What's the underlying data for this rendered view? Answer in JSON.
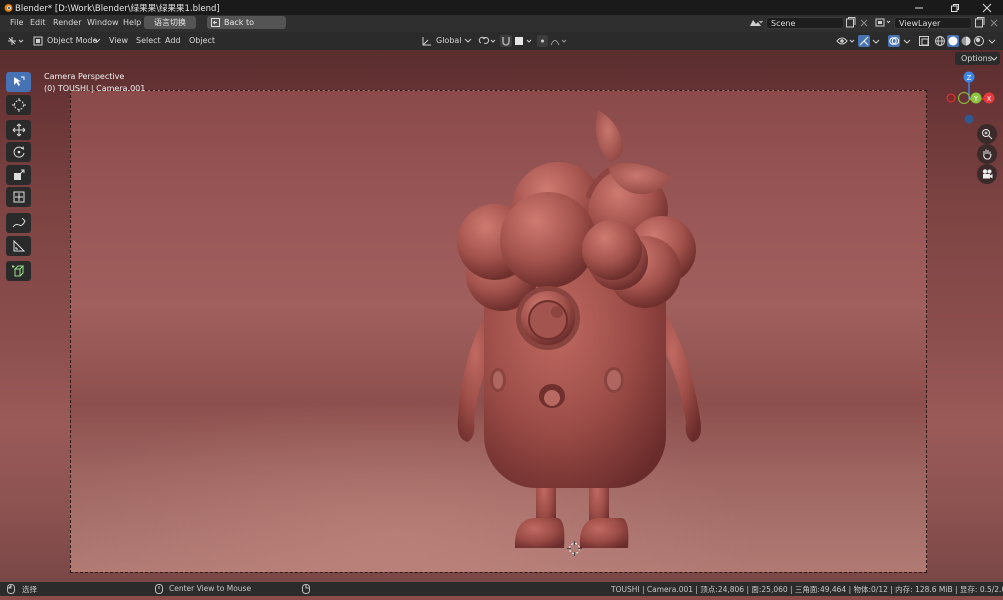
{
  "window": {
    "title": "Blender* [D:\\Work\\Blender\\绿果果\\绿果果1.blend]",
    "minimize_icon": "minimize-icon",
    "maximize_icon": "restore-icon",
    "close_icon": "close-icon"
  },
  "menu": {
    "items": [
      "File",
      "Edit",
      "Render",
      "Window",
      "Help"
    ],
    "lang_button": "语言切换",
    "back_button": "Back to Previous",
    "scene_label": "Scene",
    "viewlayer_label": "ViewLayer"
  },
  "header": {
    "mode": "Object Mode",
    "menus": [
      "View",
      "Select",
      "Add",
      "Object"
    ],
    "transform_orientation": "Global",
    "options_label": "Options"
  },
  "viewport": {
    "view_name": "Camera Perspective",
    "collection_info": "(0) TOUSHI | Camera.001",
    "gizmo_axes": [
      "Z",
      "Y",
      "X"
    ],
    "axis_colors": {
      "x": "#e8393c",
      "y": "#8bc43f",
      "z": "#3b86e8"
    }
  },
  "toolbar": {
    "tools": [
      "select-box-icon",
      "cursor-icon",
      "move-icon",
      "rotate-icon",
      "scale-icon",
      "transform-icon",
      "annotate-icon",
      "measure-icon",
      "add-cube-icon"
    ]
  },
  "status": {
    "left": "选择",
    "middle": "Center View to Mouse",
    "right": "TOUSHI | Camera.001 | 顶点:24,806 | 面:25,060 | 三角面:49,464 | 物体:0/12 | 内存: 128.6 MiB | 显存: 0.5/2.0 GiB | 3.0.0"
  },
  "colors": {
    "accent": "#4772b3",
    "model": "#a3504b"
  }
}
